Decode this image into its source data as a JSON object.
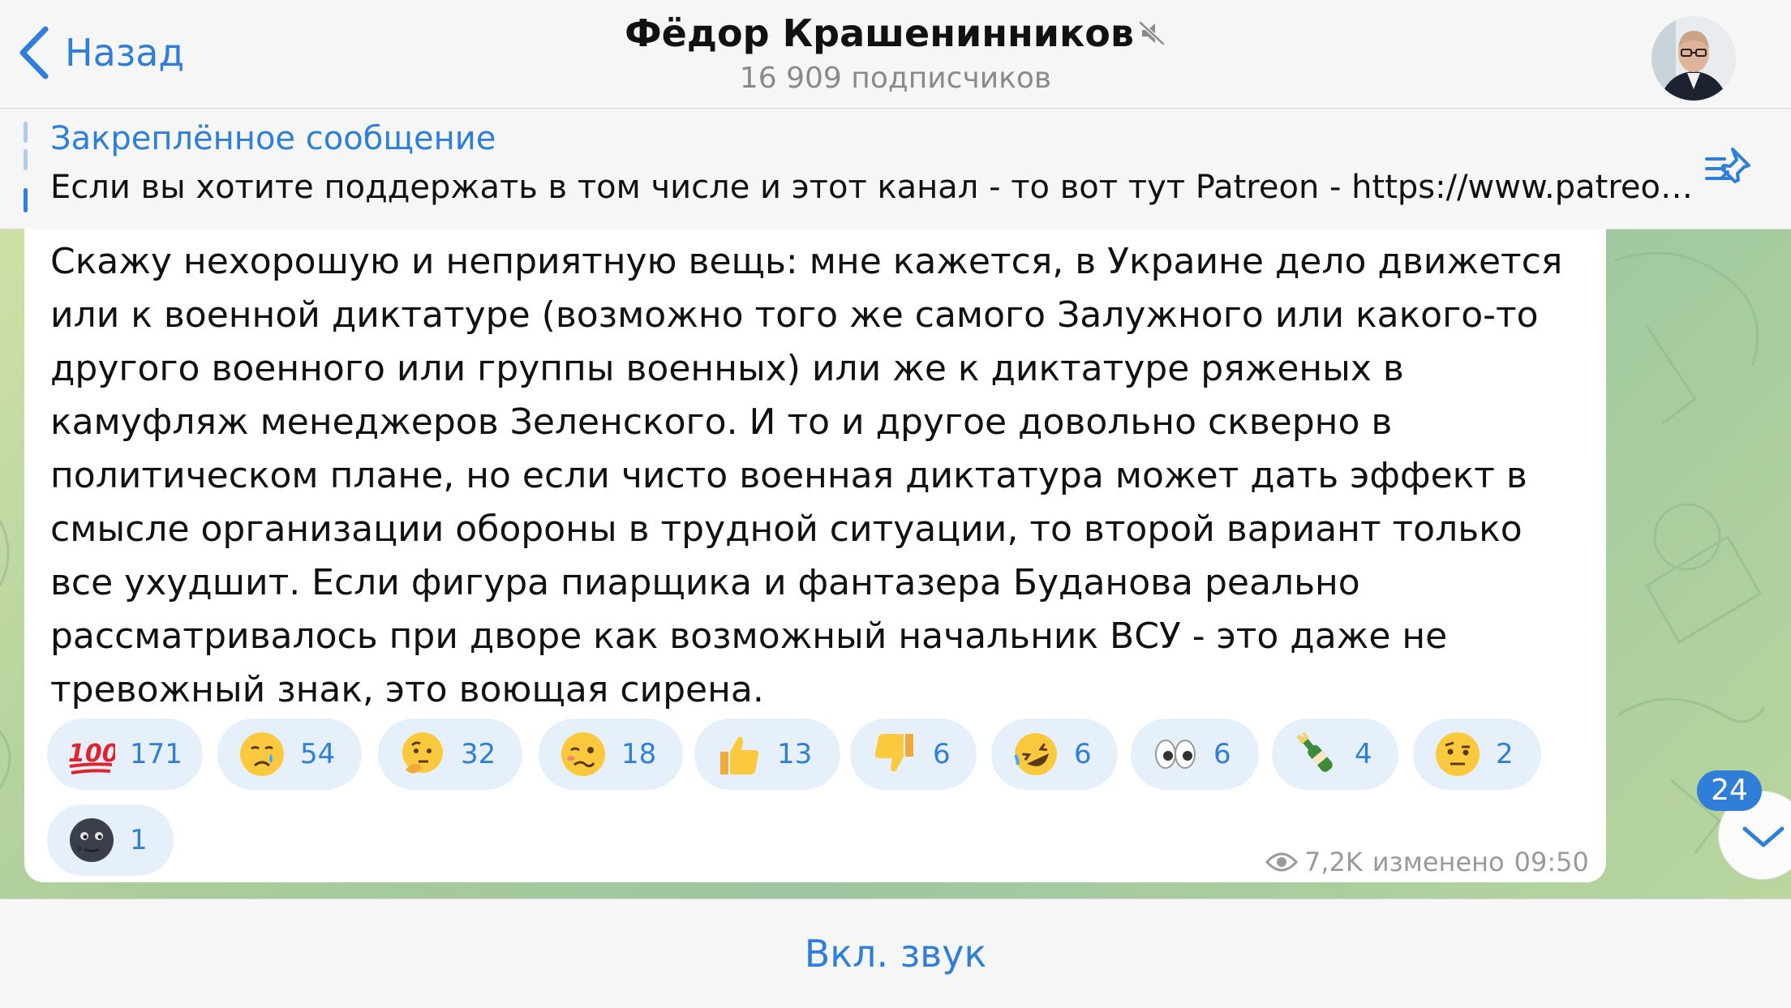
{
  "header": {
    "back_label": "Назад",
    "title": "Фёдор Крашенинников",
    "subtitle": "16 909 подписчиков",
    "mute_icon": "speaker-muted-icon",
    "avatar_icon": "channel-avatar"
  },
  "pinned": {
    "title": "Закреплённое сообщение",
    "text": "Если вы хотите поддержать в том числе и этот канал - то вот тут Patreon - https://www.patreon.com/fedorkrasheninnikov",
    "list_icon": "pinned-list-icon"
  },
  "message": {
    "lines": [
      "Скажу нехорошую и неприятную вещь: мне кажется, в Украине дело движется",
      "или к военной диктатуре (возможно того же самого Залужного или какого-то",
      "другого военного или группы военных) или же к диктатуре ряженых в",
      "камуфляж менеджеров Зеленского. И то и другое довольно скверно в",
      "политическом плане, но если чисто военная диктатура может дать эффект в",
      "смысле организации обороны в трудной ситуации, то второй вариант только",
      "все ухудшит. Если фигура пиарщика и фантазера Буданова реально",
      "рассматривалось при дворе как возможный начальник ВСУ - это даже не",
      "тревожный знак, это воющая сирена."
    ],
    "views": "7,2K",
    "edited_label": "изменено",
    "time": "09:50"
  },
  "reactions": [
    {
      "emoji": "hundred-points",
      "count": "171"
    },
    {
      "emoji": "crying-face",
      "count": "54"
    },
    {
      "emoji": "thinking-face",
      "count": "32"
    },
    {
      "emoji": "woozy-face",
      "count": "18"
    },
    {
      "emoji": "thumbs-up",
      "count": "13"
    },
    {
      "emoji": "thumbs-down",
      "count": "6"
    },
    {
      "emoji": "rolling-laughing-face",
      "count": "6"
    },
    {
      "emoji": "eyes",
      "count": "6"
    },
    {
      "emoji": "champagne-bottle",
      "count": "4"
    },
    {
      "emoji": "raised-eyebrow-face",
      "count": "2"
    },
    {
      "emoji": "new-moon-face",
      "count": "1"
    }
  ],
  "scroll": {
    "unread_count": "24",
    "icon": "chevron-down-icon"
  },
  "bottom": {
    "sound_label": "Вкл. звук"
  },
  "colors": {
    "accent": "#2f7ed8",
    "reaction_bg": "#e6f0fb",
    "bubble": "#ffffff"
  }
}
